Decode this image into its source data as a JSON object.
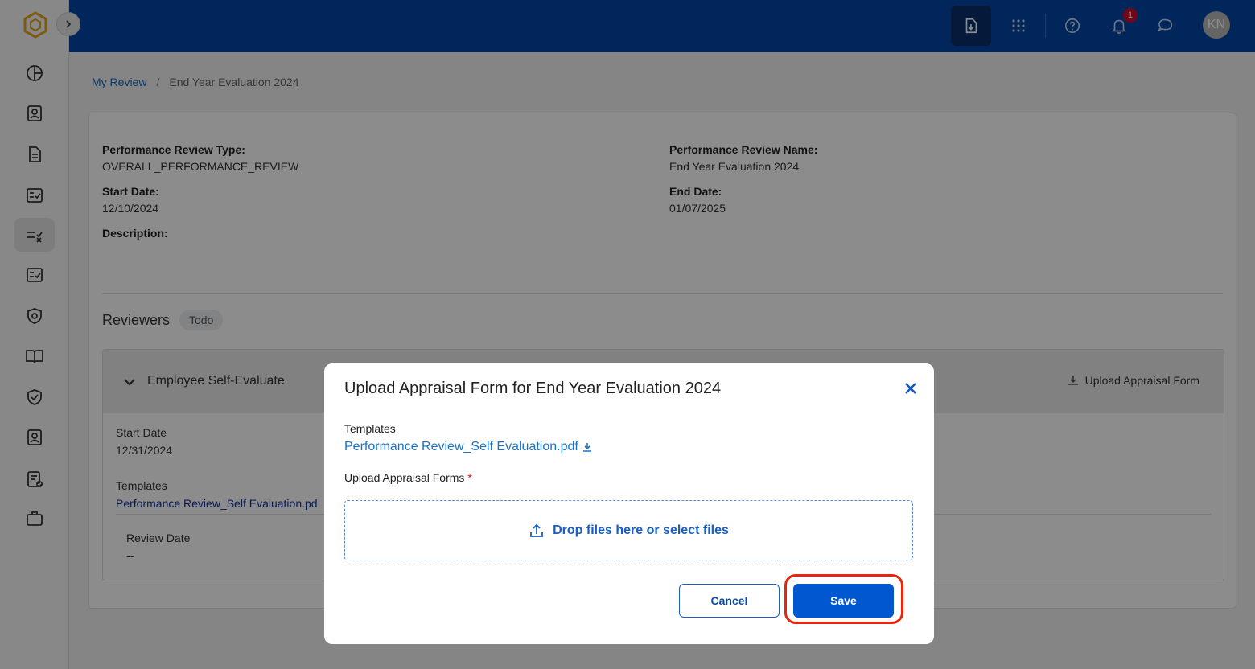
{
  "topbar": {
    "notification_count": "1",
    "avatar_initials": "KN"
  },
  "breadcrumb": {
    "parent": "My Review",
    "separator": "/",
    "current": "End Year Evaluation 2024"
  },
  "review": {
    "type_label": "Performance Review Type:",
    "type_value": "OVERALL_PERFORMANCE_REVIEW",
    "name_label": "Performance Review Name:",
    "name_value": "End Year Evaluation 2024",
    "start_label": "Start Date:",
    "start_value": "12/10/2024",
    "end_label": "End Date:",
    "end_value": "01/07/2025",
    "description_label": "Description:"
  },
  "reviewers": {
    "title": "Reviewers",
    "status_chip": "Todo",
    "section": {
      "title": "Employee Self-Evaluate",
      "upload_label": "Upload Appraisal Form",
      "start_label": "Start Date",
      "start_value": "12/31/2024",
      "templates_label": "Templates",
      "template_file": "Performance Review_Self Evaluation.pd",
      "review_date_label": "Review Date",
      "review_date_value": "--"
    }
  },
  "modal": {
    "title": "Upload Appraisal Form for End Year Evaluation 2024",
    "templates_label": "Templates",
    "template_file": "Performance Review_Self Evaluation.pdf",
    "upload_label": "Upload Appraisal Forms",
    "required_mark": "*",
    "dropzone_text": "Drop files here or select files",
    "cancel_label": "Cancel",
    "save_label": "Save"
  },
  "colors": {
    "topbar": "#0046a8",
    "primary": "#0057d0",
    "link": "#1a73c8",
    "highlight": "#e8260f",
    "badge": "#c8102e"
  }
}
